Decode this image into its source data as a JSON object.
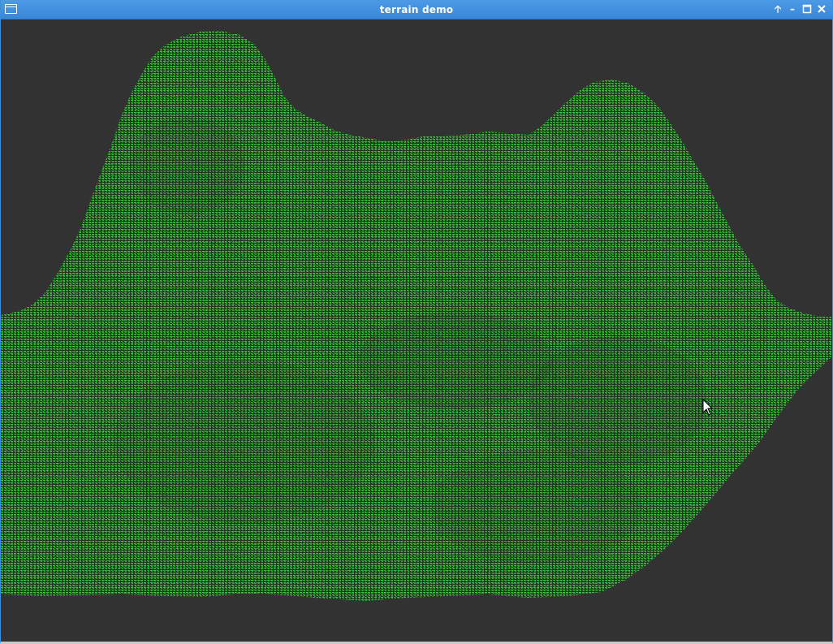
{
  "window": {
    "title": "terrain demo"
  },
  "icons": {
    "menu": "window-menu-icon",
    "shade": "arrow-up-icon",
    "minimize": "minimize-icon",
    "maximize": "maximize-icon",
    "close": "close-icon",
    "pointer": "mouse-pointer-icon"
  },
  "colors": {
    "titlebar": "#3a87d8",
    "background": "#323232",
    "terrain_green": "#2fb82f",
    "terrain_dark": "#1f4d1f"
  }
}
